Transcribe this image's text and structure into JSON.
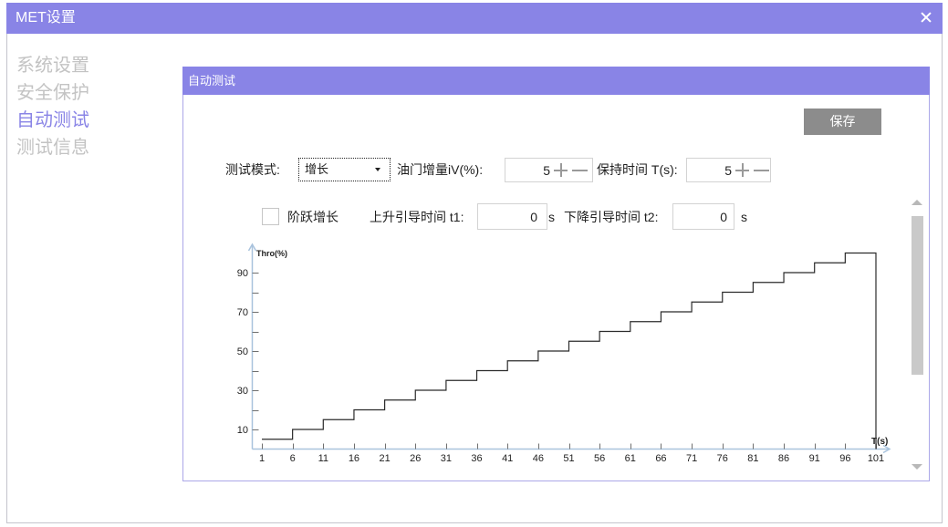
{
  "colors": {
    "accent": "#8984e6",
    "sidebar_text": "#c3c3c3",
    "save_button": "#8c8c8c",
    "axis": "#a9c3dd",
    "series_line": "#2b2b2b",
    "scroll_thumb": "#c9c9c9"
  },
  "window": {
    "title": "MET设置",
    "close_icon": "close-icon"
  },
  "sidebar": {
    "items": [
      {
        "label": "系统设置",
        "selected": false
      },
      {
        "label": "安全保护",
        "selected": false
      },
      {
        "label": "自动测试",
        "selected": true
      },
      {
        "label": "测试信息",
        "selected": false
      }
    ]
  },
  "panel": {
    "title": "自动测试",
    "save_label": "保存"
  },
  "form": {
    "mode": {
      "label": "测试模式:",
      "value": "增长",
      "icon": "dropdown-arrow-icon"
    },
    "throttle_step": {
      "label": "油门增量iV(%):",
      "value": "5",
      "increment_icon": "plus-icon",
      "decrement_icon": "minus-icon"
    },
    "hold_time": {
      "label": "保持时间 T(s):",
      "value": "5",
      "increment_icon": "plus-icon",
      "decrement_icon": "minus-icon"
    },
    "step_increase": {
      "label": "阶跃增长",
      "checked": false
    },
    "rise_time": {
      "label": "上升引导时间 t1:",
      "value": "0",
      "unit": "s"
    },
    "fall_time": {
      "label": "下降引导时间 t2:",
      "value": "0",
      "unit": "s"
    }
  },
  "scrollbar": {
    "up_icon": "scroll-up-arrow-icon",
    "down_icon": "scroll-down-arrow-icon",
    "position": 0,
    "visible_fraction": 0.65
  },
  "chart_data": {
    "type": "line",
    "step": "post",
    "xlabel": "T(s)",
    "ylabel": "Thro(%)",
    "x": [
      1,
      6,
      11,
      16,
      21,
      26,
      31,
      36,
      41,
      46,
      51,
      56,
      61,
      66,
      71,
      76,
      81,
      86,
      91,
      96,
      101
    ],
    "y": [
      5,
      10,
      15,
      20,
      25,
      30,
      35,
      40,
      45,
      50,
      55,
      60,
      65,
      70,
      75,
      80,
      85,
      90,
      95,
      100,
      0
    ],
    "x_ticks": [
      1,
      6,
      11,
      16,
      21,
      26,
      31,
      36,
      41,
      46,
      51,
      56,
      61,
      66,
      71,
      76,
      81,
      86,
      91,
      96,
      101
    ],
    "y_ticks": [
      10,
      30,
      50,
      70,
      90
    ],
    "y_minor_ticks": [
      20,
      40,
      60,
      80
    ],
    "xlim": [
      1,
      101
    ],
    "ylim": [
      0,
      100
    ],
    "grid": false
  }
}
